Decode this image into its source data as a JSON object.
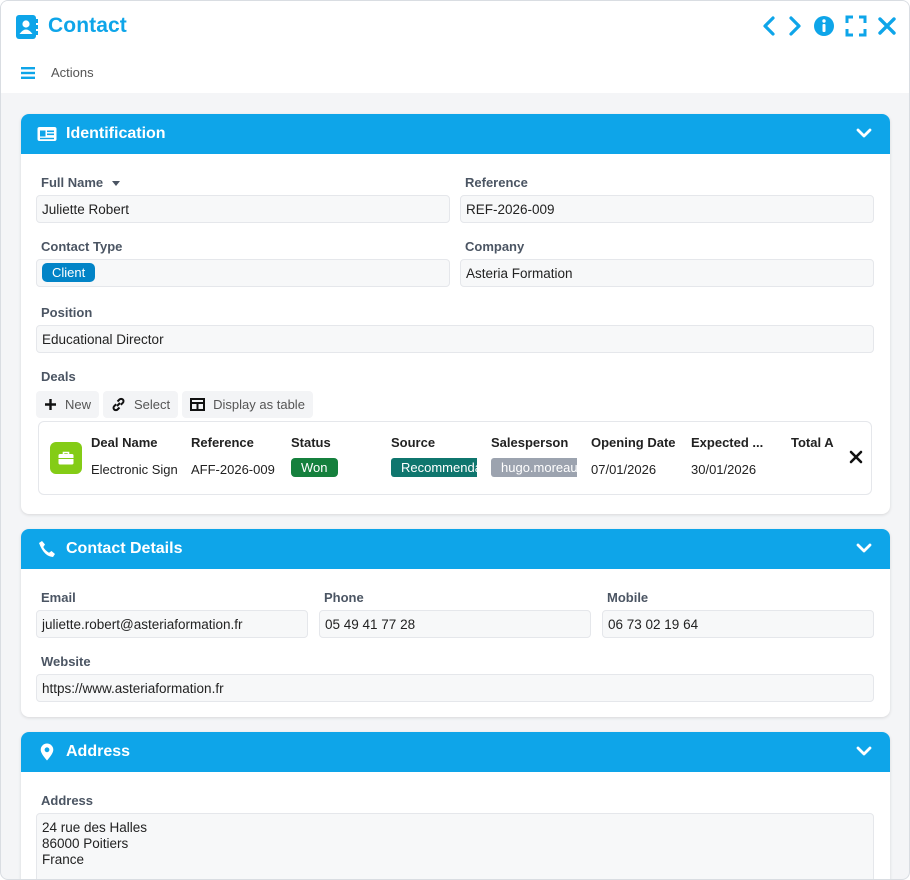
{
  "header": {
    "title": "Contact",
    "actions_label": "Actions"
  },
  "identification": {
    "title": "Identification",
    "full_name": {
      "label": "Full Name",
      "value": "Juliette Robert"
    },
    "reference": {
      "label": "Reference",
      "value": "REF-2026-009"
    },
    "contact_type": {
      "label": "Contact Type",
      "value": "Client"
    },
    "company": {
      "label": "Company",
      "value": "Asteria Formation"
    },
    "position": {
      "label": "Position",
      "value": "Educational Director"
    },
    "deals": {
      "label": "Deals",
      "buttons": {
        "new": "New",
        "select": "Select",
        "display_table": "Display as table"
      },
      "columns": [
        "Deal Name",
        "Reference",
        "Status",
        "Source",
        "Salesperson",
        "Opening Date",
        "Expected ...",
        "Total A"
      ],
      "row": {
        "deal_name": "Electronic Signature",
        "reference": "AFF-2026-009",
        "status": "Won",
        "source": "Recommendation",
        "salesperson": "hugo.moreau",
        "opening_date": "07/01/2026",
        "expected": "30/01/2026"
      }
    }
  },
  "contact_details": {
    "title": "Contact Details",
    "email": {
      "label": "Email",
      "value": "juliette.robert@asteriaformation.fr"
    },
    "phone": {
      "label": "Phone",
      "value": "05 49 41 77 28"
    },
    "mobile": {
      "label": "Mobile",
      "value": "06 73 02 19 64"
    },
    "website": {
      "label": "Website",
      "value": "https://www.asteriaformation.fr"
    }
  },
  "address": {
    "title": "Address",
    "label": "Address",
    "lines": [
      "24 rue des Halles",
      "86000 Poitiers",
      "France"
    ]
  },
  "colors": {
    "accent": "#0ea5e9",
    "won": "#15803d",
    "source": "#0f766e",
    "salesperson": "#9ca3af",
    "client_tag": "#0284c7"
  },
  "icons": [
    "contact-book-icon",
    "chevron-left-icon",
    "chevron-right-icon",
    "info-icon",
    "fullscreen-icon",
    "close-icon",
    "hamburger-icon",
    "id-card-icon",
    "phone-icon",
    "map-pin-icon",
    "chevron-down-icon",
    "plus-icon",
    "link-icon",
    "table-icon",
    "briefcase-icon"
  ]
}
